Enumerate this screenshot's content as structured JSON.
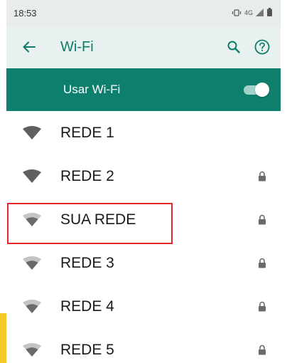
{
  "status_bar": {
    "time": "18:53",
    "network": "4G",
    "icons": [
      "vibrate-icon",
      "signal-icon",
      "battery-icon"
    ]
  },
  "app_bar": {
    "title": "Wi-Fi",
    "back_icon": "arrow-left-icon",
    "search_icon": "search-icon",
    "help_icon": "help-icon"
  },
  "master_switch": {
    "label": "Usar Wi-Fi",
    "on": true
  },
  "networks": [
    {
      "name": "REDE 1",
      "locked": false,
      "signal": "full",
      "highlighted": false
    },
    {
      "name": "REDE 2",
      "locked": true,
      "signal": "full",
      "highlighted": false
    },
    {
      "name": "SUA REDE",
      "locked": true,
      "signal": "medium",
      "highlighted": true
    },
    {
      "name": "REDE 3",
      "locked": true,
      "signal": "medium",
      "highlighted": false
    },
    {
      "name": "REDE 4",
      "locked": true,
      "signal": "medium",
      "highlighted": false
    },
    {
      "name": "REDE 5",
      "locked": true,
      "signal": "medium",
      "highlighted": false
    }
  ],
  "colors": {
    "accent": "#0f7f6d",
    "app_bar_bg": "#e8f1ef",
    "status_bar_bg": "#e9ecec",
    "highlight_border": "#e0272e",
    "side_strip": "#f7c928"
  }
}
